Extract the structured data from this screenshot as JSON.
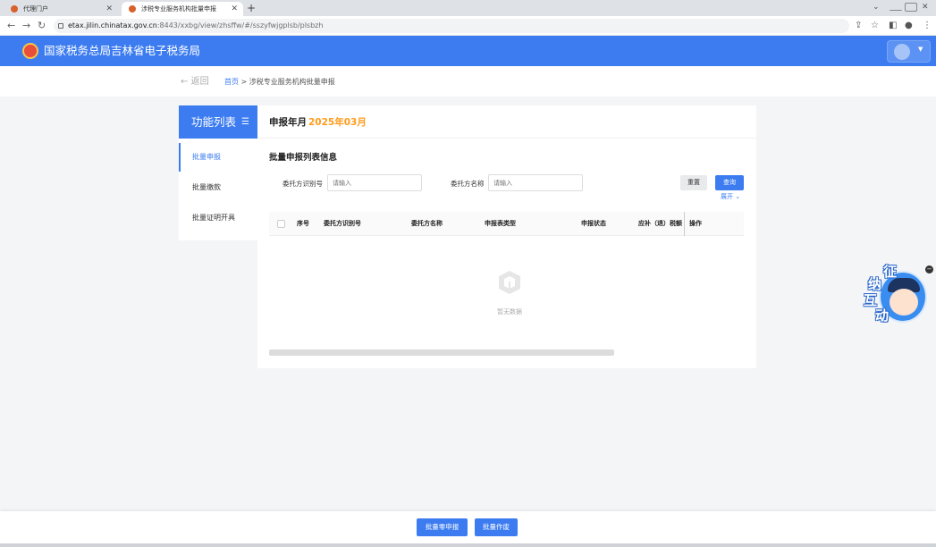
{
  "browser": {
    "tabs": [
      {
        "title": "代理门户"
      },
      {
        "title": "涉税专业服务机构批量申报"
      }
    ],
    "new_tab": "+",
    "url_host": "etax.jilin.chinatax.gov.cn",
    "url_rest": ":8443/xxbg/view/zhsffw/#/sszyfwjgplsb/plsbzh"
  },
  "site": {
    "title": "国家税务总局吉林省电子税务局"
  },
  "breadcrumb": {
    "back_label": "返回",
    "home": "首页",
    "separator": ">",
    "current": "涉税专业服务机构批量申报"
  },
  "sidebar": {
    "header": "功能列表",
    "items": [
      {
        "label": "批量申报",
        "active": true
      },
      {
        "label": "批量缴款",
        "active": false
      },
      {
        "label": "批量证明开具",
        "active": false
      }
    ]
  },
  "main": {
    "year_label": "申报年月",
    "year_value": "2025年03月",
    "section_title": "批量申报列表信息",
    "filters": {
      "client_id_label": "委托方识别号",
      "client_id_placeholder": "请输入",
      "client_name_label": "委托方名称",
      "client_name_placeholder": "请输入"
    },
    "reset_label": "重置",
    "query_label": "查询",
    "expand_label": "展开",
    "table": {
      "columns": [
        "序号",
        "委托方识别号",
        "委托方名称",
        "申报表类型",
        "申报状态",
        "应补（退）税额",
        "操作"
      ],
      "empty_text": "暂无数据"
    }
  },
  "assistant": {
    "chars": [
      "征",
      "纳",
      "互",
      "动"
    ]
  },
  "footer": {
    "zero_declare_label": "批量零申报",
    "void_label": "批量作废"
  },
  "colors": {
    "primary": "#3c7cf0",
    "accent": "#ff9b1a"
  }
}
